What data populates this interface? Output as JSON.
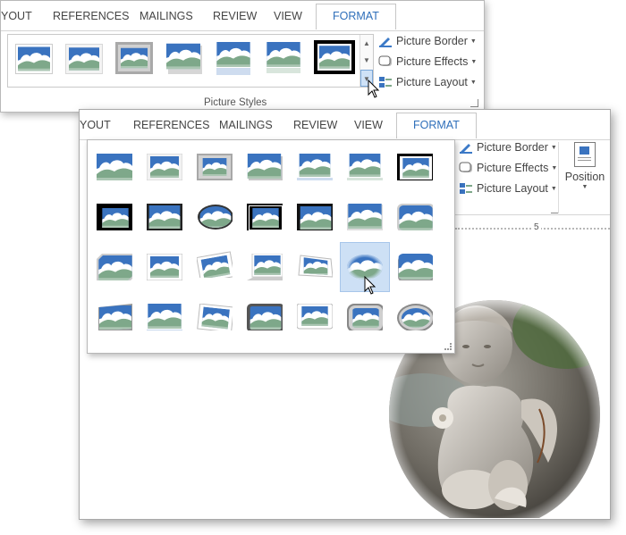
{
  "back_window": {
    "tabs": [
      "YOUT",
      "REFERENCES",
      "MAILINGS",
      "REVIEW",
      "VIEW",
      "FORMAT"
    ],
    "group_label": "Picture Styles",
    "commands": {
      "border": "Picture Border",
      "effects": "Picture Effects",
      "layout": "Picture Layout"
    }
  },
  "front_window": {
    "tabs": [
      "YOUT",
      "REFERENCES",
      "MAILINGS",
      "REVIEW",
      "VIEW",
      "FORMAT"
    ],
    "commands": {
      "border": "Picture Border",
      "effects": "Picture Effects",
      "layout": "Picture Layout"
    },
    "position_label": "Position",
    "ruler_mark": "5"
  },
  "colors": {
    "accent": "#2f6fba",
    "sky": "#3a73bf",
    "hill": "#7ea88a",
    "hover": "#cde0f5"
  },
  "icons": [
    "picture-border-icon",
    "picture-effects-icon",
    "picture-layout-icon",
    "position-icon",
    "scroll-up-icon",
    "scroll-down-icon",
    "more-icon"
  ]
}
